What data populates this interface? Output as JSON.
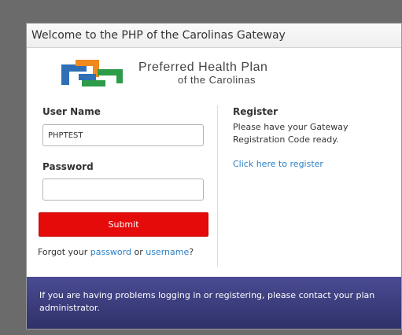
{
  "header": {
    "title": "Welcome to the PHP of the Carolinas Gateway"
  },
  "logo": {
    "name_line1": "Preferred Health Plan",
    "name_line2": "of the Carolinas"
  },
  "login": {
    "username_label": "User Name",
    "username_value": "PHPTEST",
    "password_label": "Password",
    "password_value": "",
    "submit_label": "Submit",
    "forgot_prefix": "Forgot your ",
    "forgot_password_link": "password",
    "forgot_or": " or ",
    "forgot_username_link": "username",
    "forgot_suffix": "?"
  },
  "register": {
    "title": "Register",
    "text": "Please have your Gateway Registration Code ready.",
    "link": "Click here to register"
  },
  "footer": {
    "text": "If you are having problems logging in or registering, please contact your plan administrator."
  },
  "colors": {
    "background": "#6b6b6b",
    "submit": "#e60b0b",
    "link": "#2a7fc5",
    "footer": "#3e3f82",
    "logo_blue": "#2f6fb5",
    "logo_orange": "#f08a1c",
    "logo_green": "#2e9b48"
  }
}
